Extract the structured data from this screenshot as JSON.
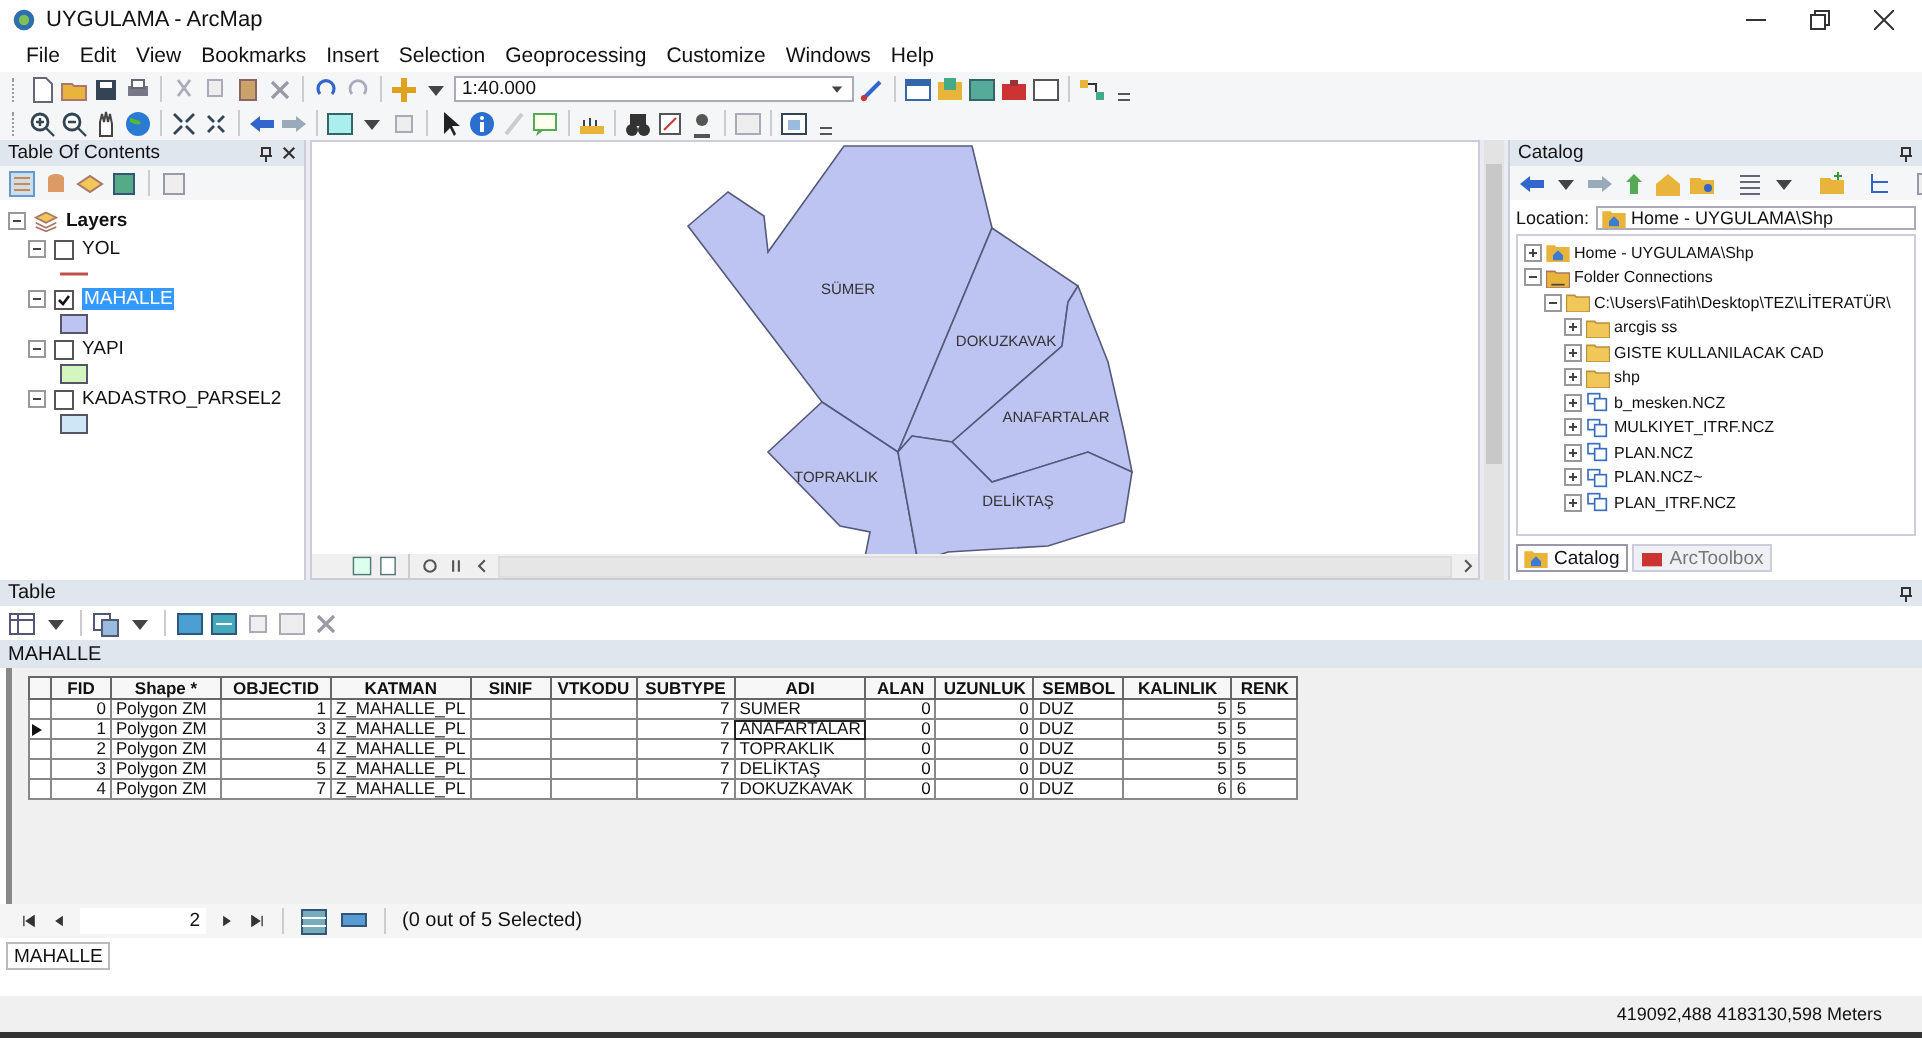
{
  "window": {
    "title": "UYGULAMA - ArcMap"
  },
  "menu": [
    "File",
    "Edit",
    "View",
    "Bookmarks",
    "Insert",
    "Selection",
    "Geoprocessing",
    "Customize",
    "Windows",
    "Help"
  ],
  "toolbar": {
    "scale": "1:40.000"
  },
  "toc": {
    "title": "Table Of Contents",
    "root": {
      "label": "Layers",
      "expanded": true
    },
    "layers": [
      {
        "name": "YOL",
        "checked": false,
        "selected": false,
        "expanded": true,
        "kind": "line",
        "color": "#c0504d"
      },
      {
        "name": "MAHALLE",
        "checked": true,
        "selected": true,
        "expanded": true,
        "kind": "fill",
        "color": "#bec4f2"
      },
      {
        "name": "YAPI",
        "checked": false,
        "selected": false,
        "expanded": true,
        "kind": "fill",
        "color": "#d3f5c0"
      },
      {
        "name": "KADASTRO_PARSEL2",
        "checked": false,
        "selected": false,
        "expanded": true,
        "kind": "fill",
        "color": "#cfe6f7"
      }
    ]
  },
  "map": {
    "labels": [
      "SÜMER",
      "DOKUZKAVAK",
      "ANAFARTALAR",
      "TOPRAKLIK",
      "DELİKTAŞ"
    ]
  },
  "catalog": {
    "title": "Catalog",
    "location_label": "Location:",
    "location": "Home - UYGULAMA\\Shp",
    "tree": [
      {
        "label": "Home - UYGULAMA\\Shp",
        "kind": "home",
        "expanded": false
      },
      {
        "label": "Folder Connections",
        "kind": "connections",
        "expanded": true,
        "children": [
          {
            "label": "C:\\Users\\Fatih\\Desktop\\TEZ\\LİTERATÜR\\",
            "kind": "folder",
            "expanded": true,
            "children": [
              {
                "label": "arcgis ss",
                "kind": "folder",
                "expanded": false
              },
              {
                "label": "GISTE KULLANILACAK CAD",
                "kind": "folder",
                "expanded": false
              },
              {
                "label": "shp",
                "kind": "folder",
                "expanded": false
              },
              {
                "label": "b_mesken.NCZ",
                "kind": "cad",
                "expanded": false
              },
              {
                "label": "MULKIYET_ITRF.NCZ",
                "kind": "cad",
                "expanded": false
              },
              {
                "label": "PLAN.NCZ",
                "kind": "cad",
                "expanded": false
              },
              {
                "label": "PLAN.NCZ~",
                "kind": "cad",
                "expanded": false
              },
              {
                "label": "PLAN_ITRF.NCZ",
                "kind": "cad",
                "expanded": false
              }
            ]
          }
        ]
      }
    ],
    "tabs": [
      {
        "label": "Catalog",
        "selected": true
      },
      {
        "label": "ArcToolbox",
        "selected": false
      }
    ]
  },
  "table": {
    "title": "Table",
    "layer": "MAHALLE",
    "columns": [
      "FID",
      "Shape *",
      "OBJECTID",
      "KATMAN",
      "SINIF",
      "VTKODU",
      "SUBTYPE",
      "ADI",
      "ALAN",
      "UZUNLUK",
      "SEMBOL",
      "KALINLIK",
      "RENK"
    ],
    "rows": [
      {
        "current": false,
        "cells": [
          "0",
          "Polygon ZM",
          "1",
          "Z_MAHALLE_PL",
          "",
          "",
          "7",
          "SUMER",
          "0",
          "0",
          "DUZ",
          "5",
          "5"
        ]
      },
      {
        "current": true,
        "cells": [
          "1",
          "Polygon ZM",
          "3",
          "Z_MAHALLE_PL",
          "",
          "",
          "7",
          {
            "text": "ANAFARTALAR",
            "focused": true
          },
          "0",
          "0",
          "DUZ",
          "5",
          "5"
        ]
      },
      {
        "current": false,
        "cells": [
          "2",
          "Polygon ZM",
          "4",
          "Z_MAHALLE_PL",
          "",
          "",
          "7",
          "TOPRAKLIK",
          "0",
          "0",
          "DUZ",
          "5",
          "5"
        ]
      },
      {
        "current": false,
        "cells": [
          "3",
          "Polygon ZM",
          "5",
          "Z_MAHALLE_PL",
          "",
          "",
          "7",
          "DELİKTAŞ",
          "0",
          "0",
          "DUZ",
          "5",
          "5"
        ]
      },
      {
        "current": false,
        "cells": [
          "4",
          "Polygon ZM",
          "7",
          "Z_MAHALLE_PL",
          "",
          "",
          "7",
          "DOKUZKAVAK",
          "0",
          "0",
          "DUZ",
          "6",
          "6"
        ]
      }
    ],
    "record": "2",
    "selection": "(0 out of 5 Selected)",
    "tabs": [
      {
        "label": "MAHALLE",
        "selected": true
      }
    ]
  },
  "status_bar": {
    "coordinates": "419092,488 4183130,598 Meters"
  }
}
